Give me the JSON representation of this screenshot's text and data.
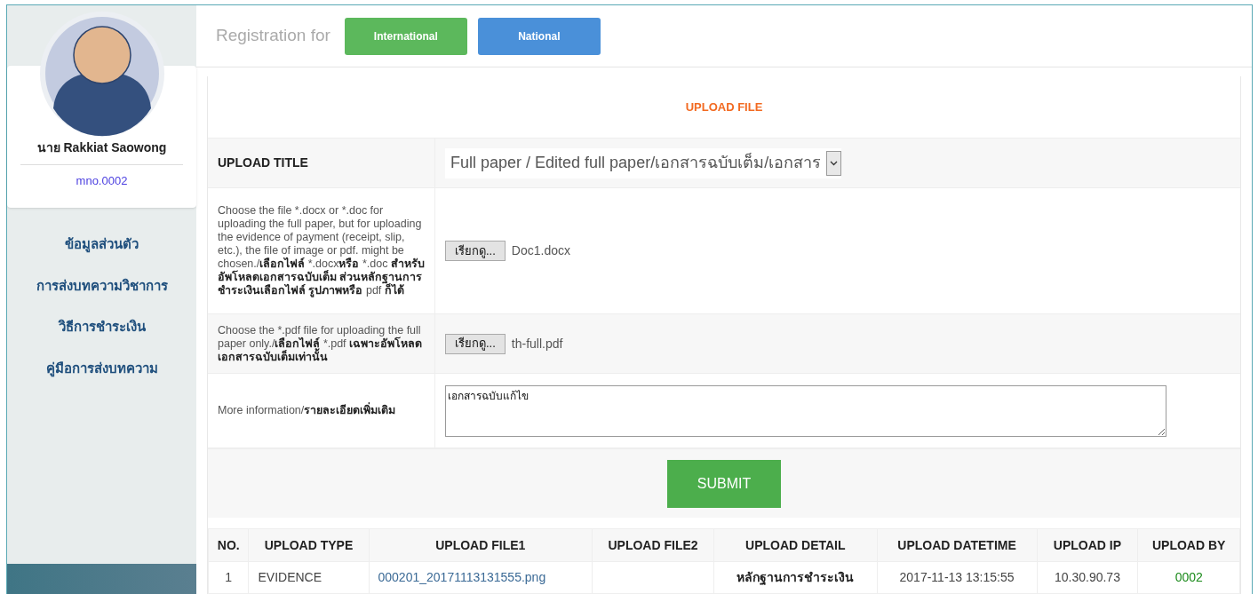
{
  "profile": {
    "name": "นาย Rakkiat Saowong",
    "member_no": "mno.0002"
  },
  "sidebar": {
    "items": [
      "ข้อมูลส่วนตัว",
      "การส่งบทความวิชาการ",
      "วิธีการชำระเงิน",
      "คู่มือการส่งบทความ"
    ]
  },
  "header": {
    "label": "Registration for",
    "buttons": [
      {
        "label": "International",
        "color": "#5cb85c"
      },
      {
        "label": "National",
        "color": "#4a90d9"
      }
    ]
  },
  "form": {
    "title": "UPLOAD FILE",
    "rows": [
      {
        "kind": "select",
        "label": "UPLOAD TITLE",
        "value": "Full paper / Edited full paper/เอกสารฉบับเต็ม/เอกสาร"
      },
      {
        "kind": "file",
        "label": [
          {
            "text": "Choose the file *.docx or *.doc for uploading the full paper, but for uploading the evidence of payment (receipt, slip, etc.), the file of image or pdf. might be chosen./",
            "bold": false
          },
          {
            "text": "เลือกไฟล์",
            "bold": true
          },
          {
            "text": " *.docx",
            "bold": false
          },
          {
            "text": "หรือ",
            "bold": true
          },
          {
            "text": " *.doc ",
            "bold": false
          },
          {
            "text": "สำหรับอัพโหลดเอกสารฉบับเต็ม ส่วนหลักฐานการชำระเงินเลือกไฟล์ รูปภาพหรือ",
            "bold": true
          },
          {
            "text": " pdf ",
            "bold": false
          },
          {
            "text": "ก็ได้",
            "bold": true
          }
        ],
        "button": "เรียกดู...",
        "file": "Doc1.docx"
      },
      {
        "kind": "file",
        "label": [
          {
            "text": "Choose the *.pdf file for uploading the full paper only./",
            "bold": false
          },
          {
            "text": "เลือกไฟล์",
            "bold": true
          },
          {
            "text": " *.pdf ",
            "bold": false
          },
          {
            "text": "เฉพาะอัพโหลดเอกสารฉบับเต็มเท่านั้น",
            "bold": true
          }
        ],
        "button": "เรียกดู...",
        "file": "th-full.pdf"
      },
      {
        "kind": "textarea",
        "label": [
          {
            "text": "More information/",
            "bold": false
          },
          {
            "text": "รายละเอียดเพิ่มเติม",
            "bold": true
          }
        ],
        "value": "เอกสารฉบับแก้ไข"
      }
    ],
    "submit": "SUBMIT"
  },
  "table": {
    "columns": [
      "NO.",
      "UPLOAD TYPE",
      "UPLOAD FILE1",
      "UPLOAD FILE2",
      "UPLOAD DETAIL",
      "UPLOAD DATETIME",
      "UPLOAD IP",
      "UPLOAD BY"
    ],
    "rows": [
      {
        "no": "1",
        "type": "EVIDENCE",
        "file1": "000201_20171113131555.png",
        "file2": "",
        "detail": "หลักฐานการชำระเงิน",
        "datetime": "2017-11-13 13:15:55",
        "ip": "10.30.90.73",
        "by": "0002"
      }
    ]
  }
}
